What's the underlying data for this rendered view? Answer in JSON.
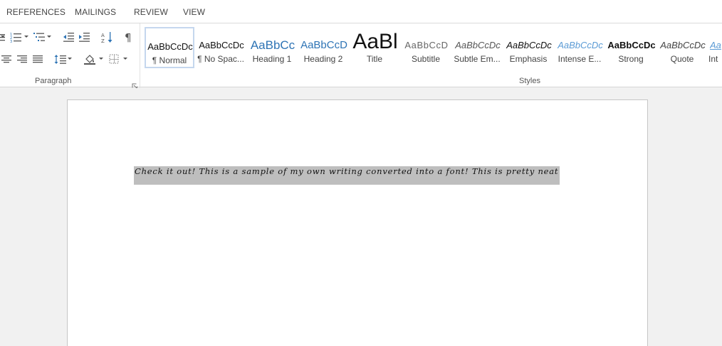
{
  "ribbon_tabs": [
    "REFERENCES",
    "MAILINGS",
    "REVIEW",
    "VIEW"
  ],
  "paragraph_group": {
    "label": "Paragraph",
    "controls": [
      "bullets-icon",
      "multilevel-list-icon",
      "decrease-indent-icon",
      "increase-indent-icon",
      "sort-icon",
      "pilcrow-icon",
      "align-center-icon",
      "align-right-icon",
      "justify-icon",
      "line-spacing-icon",
      "shading-icon",
      "borders-icon"
    ]
  },
  "styles_group": {
    "label": "Styles",
    "items": [
      {
        "preview": "AaBbCcDc",
        "label": "¶ Normal",
        "selected": true
      },
      {
        "preview": "AaBbCcDc",
        "label": "¶ No Spac...",
        "selected": false
      },
      {
        "preview": "AaBbCc",
        "label": "Heading 1",
        "selected": false
      },
      {
        "preview": "AaBbCcD",
        "label": "Heading 2",
        "selected": false
      },
      {
        "preview": "AaBl",
        "label": "Title",
        "selected": false
      },
      {
        "preview": "AaBbCcD",
        "label": "Subtitle",
        "selected": false
      },
      {
        "preview": "AaBbCcDc",
        "label": "Subtle Em...",
        "selected": false
      },
      {
        "preview": "AaBbCcDc",
        "label": "Emphasis",
        "selected": false
      },
      {
        "preview": "AaBbCcDc",
        "label": "Intense E...",
        "selected": false
      },
      {
        "preview": "AaBbCcDc",
        "label": "Strong",
        "selected": false
      },
      {
        "preview": "AaBbCcDc",
        "label": "Quote",
        "selected": false
      },
      {
        "preview": "Aa",
        "label": "Int",
        "selected": false
      }
    ]
  },
  "document": {
    "text": "Check it out! This is a sample of my own writing converted into a font! This is pretty neat",
    "selection_color": "#bebebe"
  },
  "colors": {
    "accent_heading": "#2e74b5",
    "selected_style_border": "#c5d7ee",
    "text_dark": "#111111"
  }
}
